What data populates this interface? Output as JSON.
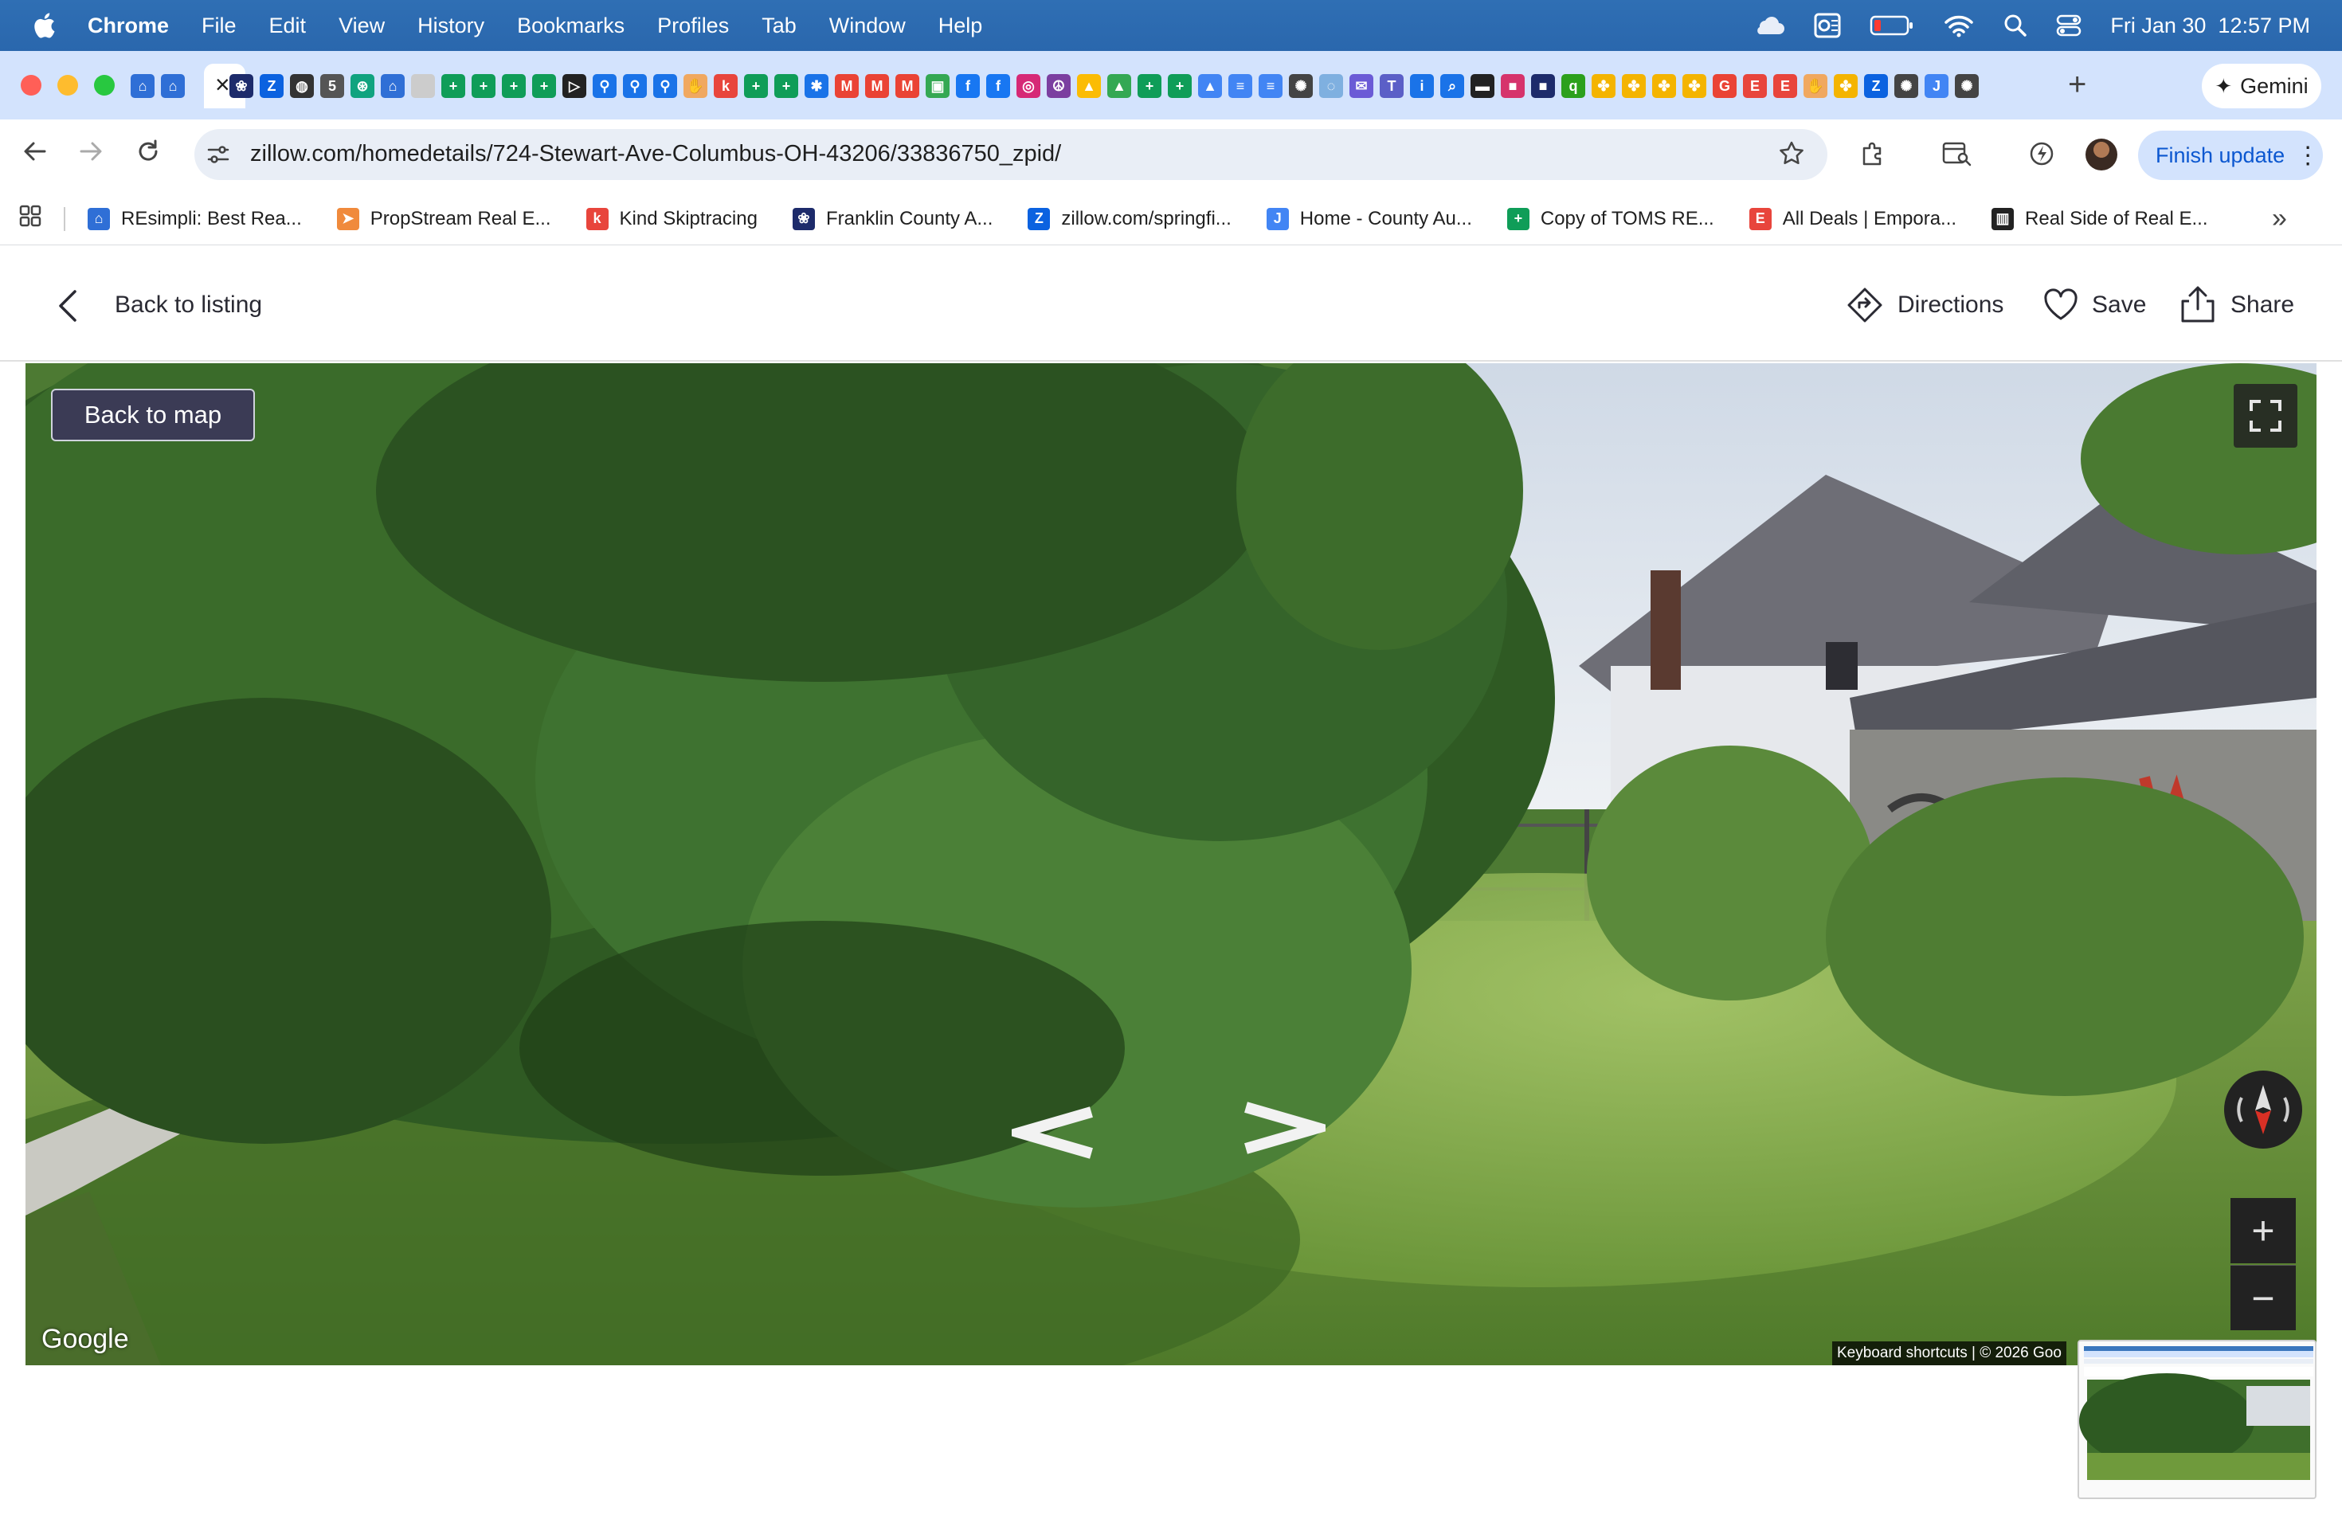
{
  "menubar": {
    "app": "Chrome",
    "items": [
      "File",
      "Edit",
      "View",
      "History",
      "Bookmarks",
      "Profiles",
      "Tab",
      "Window",
      "Help"
    ],
    "datetime": "Fri Jan 30  12:57 PM"
  },
  "tabs": {
    "close_label": "×",
    "new_tab_label": "+",
    "gemini_label": "Gemini",
    "favicons": [
      {
        "icon": "house-icon",
        "color": "#2f6fd6",
        "glyph": "⌂"
      },
      {
        "icon": "house-icon",
        "color": "#2f6fd6",
        "glyph": "⌂"
      },
      {
        "icon": "paw-icon",
        "color": "#1d2b6b",
        "glyph": "❀"
      },
      {
        "icon": "zillow-icon",
        "color": "#0b62e0",
        "glyph": "Z"
      },
      {
        "icon": "globe-icon",
        "color": "#333333",
        "glyph": "◍"
      },
      {
        "icon": "doc-icon",
        "color": "#555555",
        "glyph": "5"
      },
      {
        "icon": "chatgpt-icon",
        "color": "#10a37f",
        "glyph": "⊛"
      },
      {
        "icon": "house-icon",
        "color": "#2f6fd6",
        "glyph": "⌂"
      },
      {
        "icon": "blank-icon",
        "color": "#cccccc",
        "glyph": ""
      },
      {
        "icon": "sheets-plus-icon",
        "color": "#0f9d58",
        "glyph": "+"
      },
      {
        "icon": "sheets-plus-icon",
        "color": "#0f9d58",
        "glyph": "+"
      },
      {
        "icon": "sheets-plus-icon",
        "color": "#0f9d58",
        "glyph": "+"
      },
      {
        "icon": "sheets-plus-icon",
        "color": "#0f9d58",
        "glyph": "+"
      },
      {
        "icon": "play-icon",
        "color": "#222222",
        "glyph": "▷"
      },
      {
        "icon": "pin-icon",
        "color": "#1a73e8",
        "glyph": "⚲"
      },
      {
        "icon": "pin-icon",
        "color": "#1a73e8",
        "glyph": "⚲"
      },
      {
        "icon": "pin-icon",
        "color": "#1a73e8",
        "glyph": "⚲"
      },
      {
        "icon": "hand-icon",
        "color": "#f0a860",
        "glyph": "✋"
      },
      {
        "icon": "k-icon",
        "color": "#e8453c",
        "glyph": "k"
      },
      {
        "icon": "sheets-plus-icon",
        "color": "#0f9d58",
        "glyph": "+"
      },
      {
        "icon": "sheets-plus-icon",
        "color": "#0f9d58",
        "glyph": "+"
      },
      {
        "icon": "asterisk-icon",
        "color": "#1a73e8",
        "glyph": "✱"
      },
      {
        "icon": "gmail-icon",
        "color": "#ea4335",
        "glyph": "M"
      },
      {
        "icon": "gmail-icon",
        "color": "#ea4335",
        "glyph": "M"
      },
      {
        "icon": "gmail-icon",
        "color": "#ea4335",
        "glyph": "M"
      },
      {
        "icon": "image-icon",
        "color": "#34a853",
        "glyph": "▣"
      },
      {
        "icon": "facebook-icon",
        "color": "#1877f2",
        "glyph": "f"
      },
      {
        "icon": "facebook-icon",
        "color": "#1877f2",
        "glyph": "f"
      },
      {
        "icon": "instagram-icon",
        "color": "#d62976",
        "glyph": "◎"
      },
      {
        "icon": "peace-icon",
        "color": "#7b3fa0",
        "glyph": "☮"
      },
      {
        "icon": "drive-icon",
        "color": "#fbbc04",
        "glyph": "▲"
      },
      {
        "icon": "drive-icon",
        "color": "#34a853",
        "glyph": "▲"
      },
      {
        "icon": "sheets-plus-icon",
        "color": "#0f9d58",
        "glyph": "+"
      },
      {
        "icon": "sheets-plus-icon",
        "color": "#0f9d58",
        "glyph": "+"
      },
      {
        "icon": "drive-icon",
        "color": "#4285f4",
        "glyph": "▲"
      },
      {
        "icon": "docs-icon",
        "color": "#4285f4",
        "glyph": "≡"
      },
      {
        "icon": "docs-icon",
        "color": "#4285f4",
        "glyph": "≡"
      },
      {
        "icon": "openai-icon",
        "color": "#444444",
        "glyph": "✺"
      },
      {
        "icon": "swirl-icon",
        "color": "#7fb0e0",
        "glyph": "◌"
      },
      {
        "icon": "mail-icon",
        "color": "#6b5bd6",
        "glyph": "✉"
      },
      {
        "icon": "teams-icon",
        "color": "#5b5fc7",
        "glyph": "T"
      },
      {
        "icon": "info-icon",
        "color": "#1a73e8",
        "glyph": "i"
      },
      {
        "icon": "search-icon",
        "color": "#1a73e8",
        "glyph": "⌕"
      },
      {
        "icon": "terminal-icon",
        "color": "#222222",
        "glyph": "▬"
      },
      {
        "icon": "square-icon",
        "color": "#d6336c",
        "glyph": "■"
      },
      {
        "icon": "square-icon",
        "color": "#1d2b6b",
        "glyph": "■"
      },
      {
        "icon": "quickbooks-icon",
        "color": "#2ca01c",
        "glyph": "q"
      },
      {
        "icon": "pinwheel-icon",
        "color": "#f4b400",
        "glyph": "✤"
      },
      {
        "icon": "pinwheel-icon",
        "color": "#f4b400",
        "glyph": "✤"
      },
      {
        "icon": "pinwheel-icon",
        "color": "#f4b400",
        "glyph": "✤"
      },
      {
        "icon": "pinwheel-icon",
        "color": "#f4b400",
        "glyph": "✤"
      },
      {
        "icon": "google-icon",
        "color": "#ea4335",
        "glyph": "G"
      },
      {
        "icon": "e-icon",
        "color": "#e8453c",
        "glyph": "E"
      },
      {
        "icon": "e-icon",
        "color": "#e8453c",
        "glyph": "E"
      },
      {
        "icon": "hand-icon",
        "color": "#f0a860",
        "glyph": "✋"
      },
      {
        "icon": "pinwheel-icon",
        "color": "#f4b400",
        "glyph": "✤"
      },
      {
        "icon": "zillow-icon",
        "color": "#0b62e0",
        "glyph": "Z"
      },
      {
        "icon": "openai-icon",
        "color": "#444444",
        "glyph": "✺"
      },
      {
        "icon": "j-icon",
        "color": "#4285f4",
        "glyph": "J"
      },
      {
        "icon": "openai-icon",
        "color": "#444444",
        "glyph": "✺"
      }
    ]
  },
  "toolbar": {
    "url": "zillow.com/homedetails/724-Stewart-Ave-Columbus-OH-43206/33836750_zpid/",
    "finish_update_label": "Finish update"
  },
  "bookmarks": [
    {
      "label": "REsimpli: Best Rea...",
      "icon": "house-icon",
      "color": "#2f6fd6",
      "glyph": "⌂"
    },
    {
      "label": "PropStream Real E...",
      "icon": "propstream-icon",
      "color": "#f08a3c",
      "glyph": "➤"
    },
    {
      "label": "Kind Skiptracing",
      "icon": "k-icon",
      "color": "#e8453c",
      "glyph": "k"
    },
    {
      "label": "Franklin County A...",
      "icon": "paw-icon",
      "color": "#1d2b6b",
      "glyph": "❀"
    },
    {
      "label": "zillow.com/springfi...",
      "icon": "zillow-icon",
      "color": "#0b62e0",
      "glyph": "Z"
    },
    {
      "label": "Home - County Au...",
      "icon": "j-icon",
      "color": "#4285f4",
      "glyph": "J"
    },
    {
      "label": "Copy of TOMS RE...",
      "icon": "sheets-plus-icon",
      "color": "#0f9d58",
      "glyph": "+"
    },
    {
      "label": "All Deals | Empora...",
      "icon": "e-icon",
      "color": "#e8453c",
      "glyph": "E"
    },
    {
      "label": "Real Side of Real E...",
      "icon": "bank-icon",
      "color": "#222222",
      "glyph": "▥"
    }
  ],
  "page_header": {
    "back_label": "Back to listing",
    "directions_label": "Directions",
    "save_label": "Save",
    "share_label": "Share"
  },
  "streetview": {
    "back_to_map_label": "Back to map",
    "google_label": "Google",
    "footer_text": "Keyboard shortcuts  |  © 2026 Goo",
    "zoom_in_label": "+",
    "zoom_out_label": "−"
  },
  "colors": {
    "menubar_bg": "#2f6fb4",
    "tabstrip_bg": "#d3e3fd",
    "omnibox_bg": "#e9eef6",
    "accent_blue": "#0b57d0",
    "back_to_map_bg": "#3b3b55",
    "text_dark": "#2a2a33"
  }
}
